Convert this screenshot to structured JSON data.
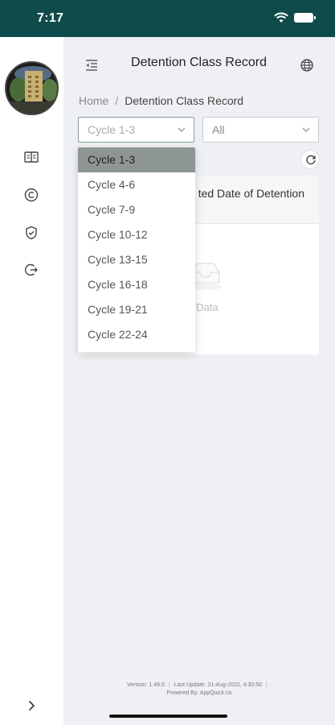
{
  "status_bar": {
    "time": "7:17"
  },
  "header": {
    "title": "Detention Class Record"
  },
  "breadcrumb": {
    "home": "Home",
    "separator": "/",
    "current": "Detention Class Record"
  },
  "filters": {
    "cycle": {
      "value": "Cycle 1-3"
    },
    "status": {
      "value": "All"
    }
  },
  "dropdown": {
    "options": [
      "Cycle 1-3",
      "Cycle 4-6",
      "Cycle 7-9",
      "Cycle 10-12",
      "Cycle 13-15",
      "Cycle 16-18",
      "Cycle 19-21",
      "Cycle 22-24"
    ],
    "selected": "Cycle 1-3"
  },
  "table": {
    "column_visible": "ted Date of Detention",
    "empty_text": "Data"
  },
  "footer": {
    "version": "Version: 1.49.0",
    "last_update": "Last Update: 31-Aug-2022, 4:30:50",
    "powered_by": "Powered By: AppQuick.co"
  },
  "colors": {
    "status_bar": "#104b4b",
    "background": "#eef0f3",
    "selected_option": "#8e9693"
  },
  "icons": {
    "sidebar": [
      "book-icon",
      "copyright-icon",
      "shield-check-icon",
      "logout-icon"
    ],
    "header_menu": "menu-fold-icon",
    "header_right": "globe-icon",
    "refresh": "reload-icon",
    "sidebar_expand": "chevron-right-icon"
  }
}
